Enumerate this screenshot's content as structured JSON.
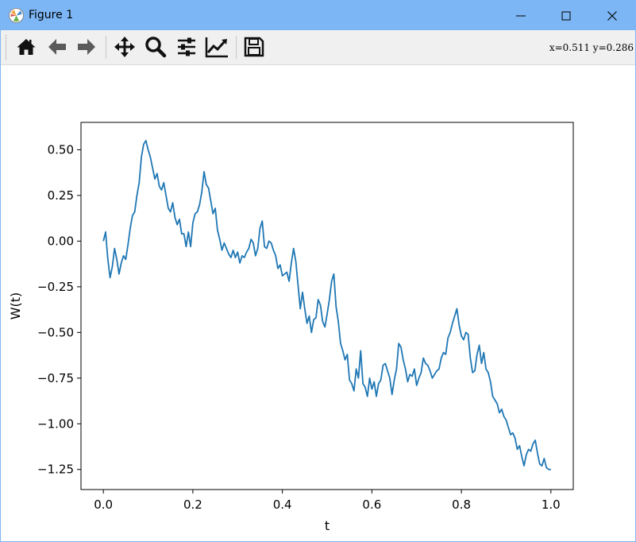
{
  "window": {
    "title": "Figure 1"
  },
  "toolbar": {
    "buttons": [
      {
        "name": "home-button",
        "icon": "home-icon"
      },
      {
        "name": "back-button",
        "icon": "arrow-left-icon"
      },
      {
        "name": "forward-button",
        "icon": "arrow-right-icon"
      },
      {
        "name": "pan-button",
        "icon": "move-icon"
      },
      {
        "name": "zoom-button",
        "icon": "magnifier-icon"
      },
      {
        "name": "configure-subplots-button",
        "icon": "sliders-icon"
      },
      {
        "name": "edit-axes-button",
        "icon": "chart-line-icon"
      },
      {
        "name": "save-button",
        "icon": "floppy-disk-icon"
      }
    ],
    "coords": "x=0.511  y=0.286"
  },
  "colors": {
    "line": "#1f77b4",
    "titlebar": "#7db6f5",
    "toolbar": "#f0f0f0"
  },
  "chart_data": {
    "type": "line",
    "title": "",
    "xlabel": "t",
    "ylabel": "W(t)",
    "xlim": [
      -0.05,
      1.05
    ],
    "ylim": [
      -1.36,
      0.65
    ],
    "xticks": [
      0.0,
      0.2,
      0.4,
      0.6,
      0.8,
      1.0
    ],
    "xtick_labels": [
      "0.0",
      "0.2",
      "0.4",
      "0.6",
      "0.8",
      "1.0"
    ],
    "yticks": [
      0.5,
      0.25,
      0.0,
      -0.25,
      -0.5,
      -0.75,
      -1.0,
      -1.25
    ],
    "ytick_labels": [
      "0.50",
      "0.25",
      "0.00",
      "−0.25",
      "−0.50",
      "−0.75",
      "−1.00",
      "−1.25"
    ],
    "grid": false,
    "series": [
      {
        "x": [
          0.0,
          0.005,
          0.01,
          0.015,
          0.02,
          0.025,
          0.03,
          0.035,
          0.04,
          0.045,
          0.05,
          0.055,
          0.06,
          0.065,
          0.07,
          0.075,
          0.08,
          0.085,
          0.09,
          0.095,
          0.1,
          0.105,
          0.11,
          0.115,
          0.12,
          0.125,
          0.13,
          0.135,
          0.14,
          0.145,
          0.15,
          0.155,
          0.16,
          0.165,
          0.17,
          0.175,
          0.18,
          0.185,
          0.19,
          0.195,
          0.2,
          0.205,
          0.21,
          0.215,
          0.22,
          0.225,
          0.23,
          0.235,
          0.24,
          0.245,
          0.25,
          0.255,
          0.26,
          0.265,
          0.27,
          0.275,
          0.28,
          0.285,
          0.29,
          0.295,
          0.3,
          0.305,
          0.31,
          0.315,
          0.32,
          0.325,
          0.33,
          0.335,
          0.34,
          0.345,
          0.35,
          0.355,
          0.36,
          0.365,
          0.37,
          0.375,
          0.38,
          0.385,
          0.39,
          0.395,
          0.4,
          0.405,
          0.41,
          0.415,
          0.42,
          0.425,
          0.43,
          0.435,
          0.44,
          0.445,
          0.45,
          0.455,
          0.46,
          0.465,
          0.47,
          0.475,
          0.48,
          0.485,
          0.49,
          0.495,
          0.5,
          0.505,
          0.51,
          0.515,
          0.52,
          0.525,
          0.53,
          0.535,
          0.54,
          0.545,
          0.55,
          0.555,
          0.56,
          0.565,
          0.57,
          0.575,
          0.58,
          0.585,
          0.59,
          0.595,
          0.6,
          0.605,
          0.61,
          0.615,
          0.62,
          0.625,
          0.63,
          0.635,
          0.64,
          0.645,
          0.65,
          0.655,
          0.66,
          0.665,
          0.67,
          0.675,
          0.68,
          0.685,
          0.69,
          0.695,
          0.7,
          0.705,
          0.71,
          0.715,
          0.72,
          0.725,
          0.73,
          0.735,
          0.74,
          0.745,
          0.75,
          0.755,
          0.76,
          0.765,
          0.77,
          0.775,
          0.78,
          0.785,
          0.79,
          0.795,
          0.8,
          0.805,
          0.81,
          0.815,
          0.82,
          0.825,
          0.83,
          0.835,
          0.84,
          0.845,
          0.85,
          0.855,
          0.86,
          0.865,
          0.87,
          0.875,
          0.88,
          0.885,
          0.89,
          0.895,
          0.9,
          0.905,
          0.91,
          0.915,
          0.92,
          0.925,
          0.93,
          0.935,
          0.94,
          0.945,
          0.95,
          0.955,
          0.96,
          0.965,
          0.97,
          0.975,
          0.98,
          0.985,
          0.99,
          0.995,
          1.0
        ],
        "y": [
          0.0,
          0.05,
          -0.1,
          -0.2,
          -0.14,
          -0.04,
          -0.1,
          -0.18,
          -0.12,
          -0.08,
          -0.1,
          -0.02,
          0.07,
          0.14,
          0.16,
          0.25,
          0.32,
          0.46,
          0.53,
          0.55,
          0.5,
          0.46,
          0.4,
          0.34,
          0.37,
          0.3,
          0.28,
          0.32,
          0.25,
          0.18,
          0.16,
          0.21,
          0.13,
          0.09,
          0.12,
          0.04,
          0.04,
          -0.03,
          0.05,
          -0.03,
          0.1,
          0.15,
          0.16,
          0.2,
          0.27,
          0.38,
          0.31,
          0.29,
          0.22,
          0.15,
          0.18,
          0.06,
          0.01,
          -0.05,
          -0.01,
          -0.04,
          -0.07,
          -0.09,
          -0.05,
          -0.09,
          -0.06,
          -0.12,
          -0.08,
          -0.09,
          -0.06,
          -0.04,
          0.01,
          -0.01,
          -0.08,
          -0.04,
          0.07,
          0.11,
          -0.03,
          -0.04,
          0.0,
          -0.01,
          -0.05,
          -0.08,
          -0.15,
          -0.13,
          -0.19,
          -0.18,
          -0.17,
          -0.22,
          -0.12,
          -0.04,
          -0.11,
          -0.24,
          -0.37,
          -0.28,
          -0.37,
          -0.45,
          -0.41,
          -0.5,
          -0.43,
          -0.42,
          -0.32,
          -0.35,
          -0.44,
          -0.47,
          -0.4,
          -0.32,
          -0.22,
          -0.18,
          -0.36,
          -0.44,
          -0.56,
          -0.6,
          -0.65,
          -0.62,
          -0.76,
          -0.78,
          -0.82,
          -0.7,
          -0.75,
          -0.6,
          -0.78,
          -0.8,
          -0.85,
          -0.75,
          -0.81,
          -0.77,
          -0.85,
          -0.78,
          -0.76,
          -0.68,
          -0.67,
          -0.71,
          -0.75,
          -0.84,
          -0.76,
          -0.7,
          -0.56,
          -0.58,
          -0.65,
          -0.7,
          -0.77,
          -0.73,
          -0.74,
          -0.7,
          -0.79,
          -0.75,
          -0.72,
          -0.64,
          -0.67,
          -0.68,
          -0.71,
          -0.75,
          -0.73,
          -0.71,
          -0.7,
          -0.64,
          -0.61,
          -0.62,
          -0.53,
          -0.5,
          -0.45,
          -0.41,
          -0.37,
          -0.46,
          -0.52,
          -0.54,
          -0.5,
          -0.51,
          -0.64,
          -0.72,
          -0.71,
          -0.62,
          -0.57,
          -0.67,
          -0.61,
          -0.7,
          -0.72,
          -0.77,
          -0.85,
          -0.87,
          -0.89,
          -0.94,
          -0.92,
          -0.96,
          -0.98,
          -1.02,
          -1.06,
          -1.05,
          -1.08,
          -1.14,
          -1.12,
          -1.18,
          -1.23,
          -1.17,
          -1.14,
          -1.15,
          -1.11,
          -1.09,
          -1.16,
          -1.22,
          -1.23,
          -1.19,
          -1.24,
          -1.25,
          -1.25
        ]
      }
    ]
  }
}
